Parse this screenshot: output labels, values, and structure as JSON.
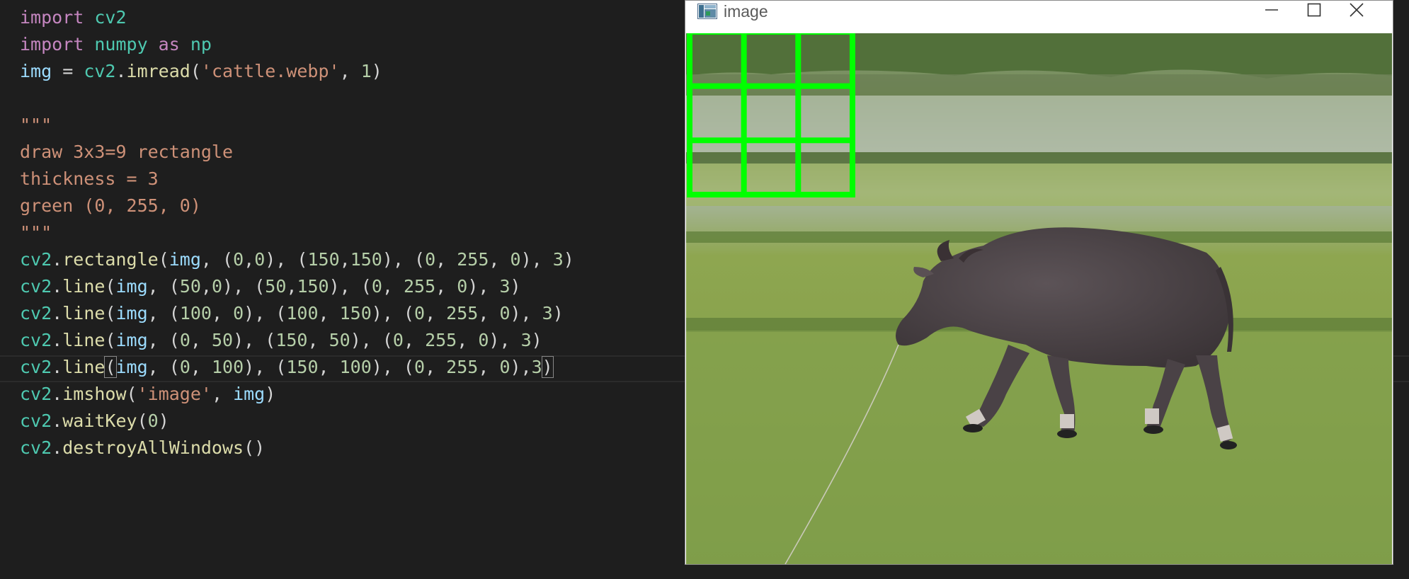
{
  "editor": {
    "lines": [
      [
        [
          "import ",
          "k-import"
        ],
        [
          "cv2",
          "k-mod"
        ]
      ],
      [
        [
          "import ",
          "k-import"
        ],
        [
          "numpy ",
          "k-mod"
        ],
        [
          "as ",
          "k-import"
        ],
        [
          "np",
          "k-mod"
        ]
      ],
      [
        [
          "img",
          "k-var"
        ],
        [
          " = ",
          "k-punc"
        ],
        [
          "cv2",
          "k-mod"
        ],
        [
          ".",
          "k-punc"
        ],
        [
          "imread",
          "k-fn"
        ],
        [
          "(",
          "k-punc"
        ],
        [
          "'cattle.webp'",
          "k-str"
        ],
        [
          ", ",
          "k-punc"
        ],
        [
          "1",
          "k-num"
        ],
        [
          ")",
          "k-punc"
        ]
      ],
      [],
      [
        [
          "\"\"\"",
          "k-doc"
        ]
      ],
      [
        [
          "draw 3x3=9 rectangle",
          "k-doc"
        ]
      ],
      [
        [
          "thickness = 3",
          "k-doc"
        ]
      ],
      [
        [
          "green (0, 255, 0)",
          "k-doc"
        ]
      ],
      [
        [
          "\"\"\"",
          "k-doc"
        ]
      ],
      [
        [
          "cv2",
          "k-mod"
        ],
        [
          ".",
          "k-punc"
        ],
        [
          "rectangle",
          "k-fn"
        ],
        [
          "(",
          "k-punc"
        ],
        [
          "img",
          "k-var"
        ],
        [
          ", (",
          "k-punc"
        ],
        [
          "0",
          "k-num"
        ],
        [
          ",",
          "k-punc"
        ],
        [
          "0",
          "k-num"
        ],
        [
          "), (",
          "k-punc"
        ],
        [
          "150",
          "k-num"
        ],
        [
          ",",
          "k-punc"
        ],
        [
          "150",
          "k-num"
        ],
        [
          "), (",
          "k-punc"
        ],
        [
          "0",
          "k-num"
        ],
        [
          ", ",
          "k-punc"
        ],
        [
          "255",
          "k-num"
        ],
        [
          ", ",
          "k-punc"
        ],
        [
          "0",
          "k-num"
        ],
        [
          "), ",
          "k-punc"
        ],
        [
          "3",
          "k-num"
        ],
        [
          ")",
          "k-punc"
        ]
      ],
      [
        [
          "cv2",
          "k-mod"
        ],
        [
          ".",
          "k-punc"
        ],
        [
          "line",
          "k-fn"
        ],
        [
          "(",
          "k-punc"
        ],
        [
          "img",
          "k-var"
        ],
        [
          ", (",
          "k-punc"
        ],
        [
          "50",
          "k-num"
        ],
        [
          ",",
          "k-punc"
        ],
        [
          "0",
          "k-num"
        ],
        [
          "), (",
          "k-punc"
        ],
        [
          "50",
          "k-num"
        ],
        [
          ",",
          "k-punc"
        ],
        [
          "150",
          "k-num"
        ],
        [
          "), (",
          "k-punc"
        ],
        [
          "0",
          "k-num"
        ],
        [
          ", ",
          "k-punc"
        ],
        [
          "255",
          "k-num"
        ],
        [
          ", ",
          "k-punc"
        ],
        [
          "0",
          "k-num"
        ],
        [
          "), ",
          "k-punc"
        ],
        [
          "3",
          "k-num"
        ],
        [
          ")",
          "k-punc"
        ]
      ],
      [
        [
          "cv2",
          "k-mod"
        ],
        [
          ".",
          "k-punc"
        ],
        [
          "line",
          "k-fn"
        ],
        [
          "(",
          "k-punc"
        ],
        [
          "img",
          "k-var"
        ],
        [
          ", (",
          "k-punc"
        ],
        [
          "100",
          "k-num"
        ],
        [
          ", ",
          "k-punc"
        ],
        [
          "0",
          "k-num"
        ],
        [
          "), (",
          "k-punc"
        ],
        [
          "100",
          "k-num"
        ],
        [
          ", ",
          "k-punc"
        ],
        [
          "150",
          "k-num"
        ],
        [
          "), (",
          "k-punc"
        ],
        [
          "0",
          "k-num"
        ],
        [
          ", ",
          "k-punc"
        ],
        [
          "255",
          "k-num"
        ],
        [
          ", ",
          "k-punc"
        ],
        [
          "0",
          "k-num"
        ],
        [
          "), ",
          "k-punc"
        ],
        [
          "3",
          "k-num"
        ],
        [
          ")",
          "k-punc"
        ]
      ],
      [
        [
          "cv2",
          "k-mod"
        ],
        [
          ".",
          "k-punc"
        ],
        [
          "line",
          "k-fn"
        ],
        [
          "(",
          "k-punc"
        ],
        [
          "img",
          "k-var"
        ],
        [
          ", (",
          "k-punc"
        ],
        [
          "0",
          "k-num"
        ],
        [
          ", ",
          "k-punc"
        ],
        [
          "50",
          "k-num"
        ],
        [
          "), (",
          "k-punc"
        ],
        [
          "150",
          "k-num"
        ],
        [
          ", ",
          "k-punc"
        ],
        [
          "50",
          "k-num"
        ],
        [
          "), (",
          "k-punc"
        ],
        [
          "0",
          "k-num"
        ],
        [
          ", ",
          "k-punc"
        ],
        [
          "255",
          "k-num"
        ],
        [
          ", ",
          "k-punc"
        ],
        [
          "0",
          "k-num"
        ],
        [
          "), ",
          "k-punc"
        ],
        [
          "3",
          "k-num"
        ],
        [
          ")",
          "k-punc"
        ]
      ],
      [
        [
          "cv2",
          "k-mod"
        ],
        [
          ".",
          "k-punc"
        ],
        [
          "line",
          "k-fn"
        ],
        [
          "(",
          "k-punc bracket-match"
        ],
        [
          "img",
          "k-var"
        ],
        [
          ", (",
          "k-punc"
        ],
        [
          "0",
          "k-num"
        ],
        [
          ", ",
          "k-punc"
        ],
        [
          "100",
          "k-num"
        ],
        [
          "), (",
          "k-punc"
        ],
        [
          "150",
          "k-num"
        ],
        [
          ", ",
          "k-punc"
        ],
        [
          "100",
          "k-num"
        ],
        [
          "), (",
          "k-punc"
        ],
        [
          "0",
          "k-num"
        ],
        [
          ", ",
          "k-punc"
        ],
        [
          "255",
          "k-num"
        ],
        [
          ", ",
          "k-punc"
        ],
        [
          "0",
          "k-num"
        ],
        [
          "),",
          "k-punc"
        ],
        [
          "3",
          "k-num"
        ],
        [
          ")",
          "k-punc bracket-match"
        ]
      ],
      [
        [
          "cv2",
          "k-mod"
        ],
        [
          ".",
          "k-punc"
        ],
        [
          "imshow",
          "k-fn"
        ],
        [
          "(",
          "k-punc"
        ],
        [
          "'image'",
          "k-str"
        ],
        [
          ", ",
          "k-punc"
        ],
        [
          "img",
          "k-var"
        ],
        [
          ")",
          "k-punc"
        ]
      ],
      [
        [
          "cv2",
          "k-mod"
        ],
        [
          ".",
          "k-punc"
        ],
        [
          "waitKey",
          "k-fn"
        ],
        [
          "(",
          "k-punc"
        ],
        [
          "0",
          "k-num"
        ],
        [
          ")",
          "k-punc"
        ]
      ],
      [
        [
          "cv2",
          "k-mod"
        ],
        [
          ".",
          "k-punc"
        ],
        [
          "destroyAllWindows",
          "k-fn"
        ],
        [
          "()",
          "k-punc"
        ]
      ]
    ]
  },
  "window": {
    "title": "image",
    "icons": {
      "app": "app-window-icon",
      "minimize": "minimize-icon",
      "maximize": "maximize-icon",
      "close": "close-icon"
    }
  },
  "colors": {
    "editor_bg": "#1e1e1e",
    "grid_green": "#00ff00",
    "grass": "#7a9a4a",
    "buffalo": "#4b4346"
  }
}
